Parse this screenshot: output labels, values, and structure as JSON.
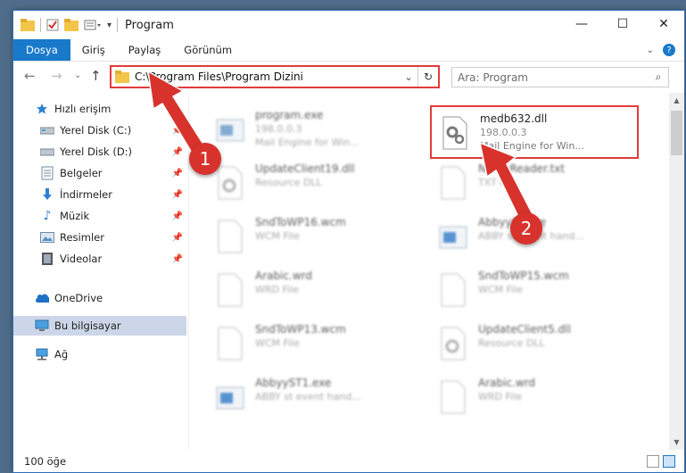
{
  "window": {
    "title": "Program",
    "controls": {
      "minimize": "—",
      "maximize": "☐",
      "close": "✕"
    }
  },
  "ribbon": {
    "tabs": [
      "Dosya",
      "Giriş",
      "Paylaş",
      "Görünüm"
    ]
  },
  "address": {
    "path": "C:\\Program Files\\Program Dizini"
  },
  "search": {
    "placeholder": "Ara: Program"
  },
  "nav": {
    "items": [
      {
        "label": "Hızlı erişim",
        "icon": "star-icon"
      },
      {
        "label": "Yerel Disk (C:)",
        "icon": "drive-icon",
        "pinned": true
      },
      {
        "label": "Yerel Disk (D:)",
        "icon": "drive-icon",
        "pinned": true
      },
      {
        "label": "Belgeler",
        "icon": "documents-icon",
        "pinned": true
      },
      {
        "label": "İndirmeler",
        "icon": "download-icon",
        "pinned": true
      },
      {
        "label": "Müzik",
        "icon": "music-icon",
        "pinned": true
      },
      {
        "label": "Resimler",
        "icon": "pictures-icon",
        "pinned": true
      },
      {
        "label": "Videolar",
        "icon": "videos-icon",
        "pinned": true
      },
      {
        "label": "OneDrive",
        "icon": "onedrive-icon"
      },
      {
        "label": "Bu bilgisayar",
        "icon": "computer-icon",
        "selected": true
      },
      {
        "label": "Ağ",
        "icon": "network-icon"
      }
    ]
  },
  "files": [
    {
      "name": "program.exe",
      "line2": "198.0.0.3",
      "line3": "Mail Engine for Win...",
      "icon": "exe-icon",
      "blurred": true
    },
    {
      "name": "medb632.dll",
      "line2": "198.0.0.3",
      "line3": "Mail Engine for Win...",
      "icon": "dll-gear-icon",
      "blurred": false,
      "highlight": true
    },
    {
      "name": "UpdateClient19.dll",
      "line2": "Resource DLL",
      "line3": "",
      "icon": "dll-icon",
      "blurred": true
    },
    {
      "name": "NameReader.txt",
      "line2": "TXT File",
      "line3": "",
      "icon": "file-icon",
      "blurred": true
    },
    {
      "name": "SndToWP16.wcm",
      "line2": "WCM File",
      "line3": "",
      "icon": "file-icon",
      "blurred": true
    },
    {
      "name": "AbbyyST.exe",
      "line2": "ABBY st event hand...",
      "line3": "",
      "icon": "exe-icon",
      "blurred": true
    },
    {
      "name": "Arabic.wrd",
      "line2": "WRD File",
      "line3": "",
      "icon": "file-icon",
      "blurred": true
    },
    {
      "name": "SndToWP15.wcm",
      "line2": "WCM File",
      "line3": "",
      "icon": "file-icon",
      "blurred": true
    },
    {
      "name": "SndToWP13.wcm",
      "line2": "WCM File",
      "line3": "",
      "icon": "file-icon",
      "blurred": true
    },
    {
      "name": "UpdateClient5.dll",
      "line2": "Resource DLL",
      "line3": "",
      "icon": "dll-icon",
      "blurred": true
    },
    {
      "name": "AbbyyST1.exe",
      "line2": "ABBY st event hand...",
      "line3": "",
      "icon": "exe-icon",
      "blurred": true
    },
    {
      "name": "Arabic.wrd",
      "line2": "WRD File",
      "line3": "",
      "icon": "file-icon",
      "blurred": true
    }
  ],
  "status": {
    "count": "100 öğe"
  },
  "annotations": {
    "badge1": "1",
    "badge2": "2",
    "color": "#d7332c"
  }
}
